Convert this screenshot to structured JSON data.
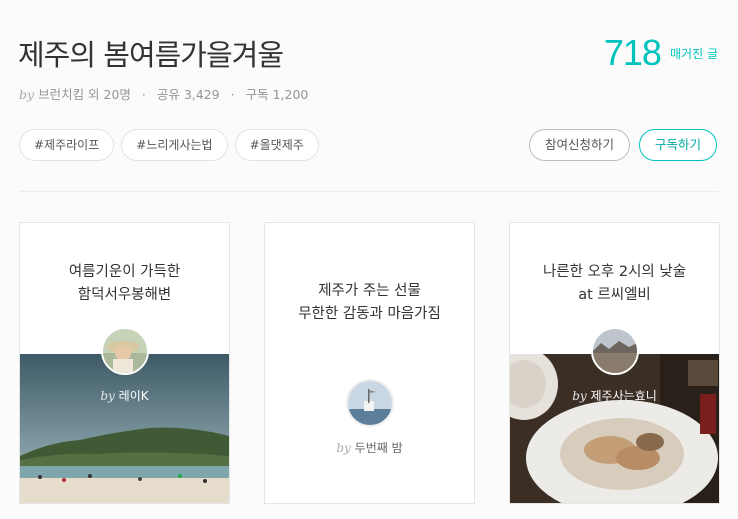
{
  "magazine": {
    "title": "제주의 봄여름가을겨울",
    "article_count": "718",
    "article_label": "매거진 글",
    "meta": {
      "by": "by",
      "author": "브런치킴 외 20명",
      "share": "공유 3,429",
      "subscribe": "구독 1,200",
      "separator": "·"
    }
  },
  "tags": [
    "#제주라이프",
    "#느리게사는법",
    "#올댓제주"
  ],
  "actions": {
    "join": "참여신청하기",
    "subscribe": "구독하기"
  },
  "colors": {
    "accent": "#00c3bd",
    "text": "#333333",
    "muted": "#959595"
  },
  "cards": [
    {
      "title_line1": "여름기운이 가득한",
      "title_line2": "함덕서우봉해변",
      "by": "by",
      "author": "레이K"
    },
    {
      "title_line1": "제주가 주는 선물",
      "title_line2": "무한한 감동과 마음가짐",
      "by": "by",
      "author": "두번째 밤"
    },
    {
      "title_line1": "나른한 오후 2시의 낮술",
      "title_line2": "at 르씨엘비",
      "by": "by",
      "author": "제주사는효니"
    }
  ]
}
